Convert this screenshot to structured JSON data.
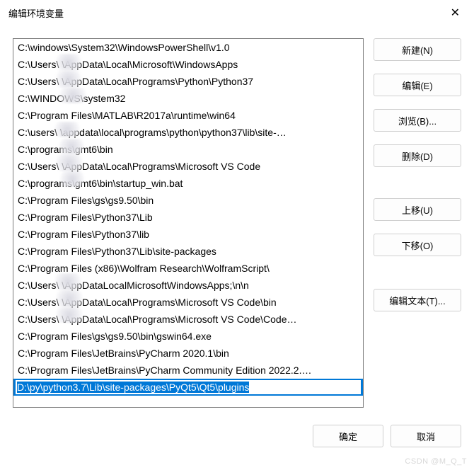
{
  "window": {
    "title": "编辑环境变量"
  },
  "list": {
    "items": [
      "C:\\windows\\System32\\WindowsPowerShell\\v1.0",
      "C:\\Users\\    \\AppData\\Local\\Microsoft\\WindowsApps",
      "C:\\Users\\    \\AppData\\Local\\Programs\\Python\\Python37",
      "C:\\WINDOWS\\system32",
      "C:\\Program Files\\MATLAB\\R2017a\\runtime\\win64",
      "C:\\users\\    \\appdata\\local\\programs\\python\\python37\\lib\\site-…",
      "C:\\programs\\gmt6\\bin",
      "C:\\Users\\    \\AppData\\Local\\Programs\\Microsoft VS Code",
      "C:\\programs\\gmt6\\bin\\startup_win.bat",
      "C:\\Program Files\\gs\\gs9.50\\bin",
      "C:\\Program Files\\Python37\\Lib",
      "C:\\Program Files\\Python37\\lib",
      "C:\\Program Files\\Python37\\Lib\\site-packages",
      "C:\\Program Files (x86)\\Wolfram Research\\WolframScript\\",
      "C:\\Users\\    \\AppDataLocalMicrosoftWindowsApps;\\n\\n",
      "C:\\Users\\    \\AppData\\Local\\Programs\\Microsoft VS Code\\bin",
      "C:\\Users\\    \\AppData\\Local\\Programs\\Microsoft VS Code\\Code…",
      "C:\\Program Files\\gs\\gs9.50\\bin\\gswin64.exe",
      "C:\\Program Files\\JetBrains\\PyCharm 2020.1\\bin",
      "C:\\Program Files\\JetBrains\\PyCharm Community Edition 2022.2.…"
    ],
    "editing_value": "D:\\py\\python3.7\\Lib\\site-packages\\PyQt5\\Qt5\\plugins"
  },
  "buttons": {
    "new": "新建(N)",
    "edit": "编辑(E)",
    "browse": "浏览(B)...",
    "delete": "删除(D)",
    "move_up": "上移(U)",
    "move_down": "下移(O)",
    "edit_text": "编辑文本(T)...",
    "ok": "确定",
    "cancel": "取消"
  },
  "watermark": "CSDN @M_Q_T"
}
